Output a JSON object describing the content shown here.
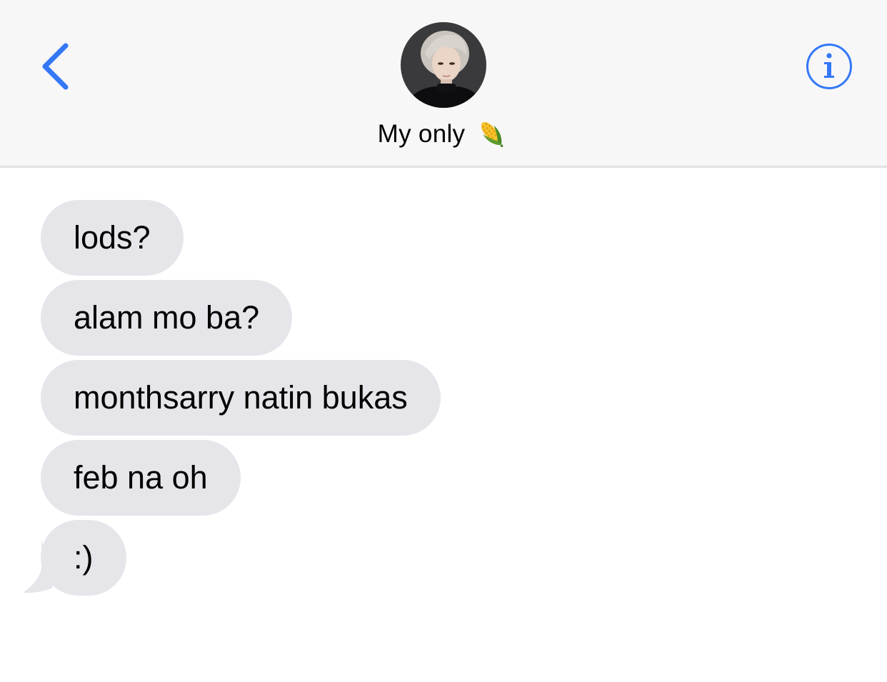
{
  "header": {
    "back_icon": "chevron-left-icon",
    "info_icon": "info-circle-icon",
    "contact_name": "My only",
    "contact_emoji": "corn-emoji-icon",
    "accent_color": "#3478f6"
  },
  "messages": [
    {
      "text": "lods?"
    },
    {
      "text": "alam mo ba?"
    },
    {
      "text": "monthsarry natin bukas"
    },
    {
      "text": "feb na oh"
    },
    {
      "text": ":)"
    }
  ],
  "colors": {
    "header_background": "#f7f7f8",
    "incoming_bubble": "#e5e5ea",
    "thread_background": "#ffffff"
  }
}
